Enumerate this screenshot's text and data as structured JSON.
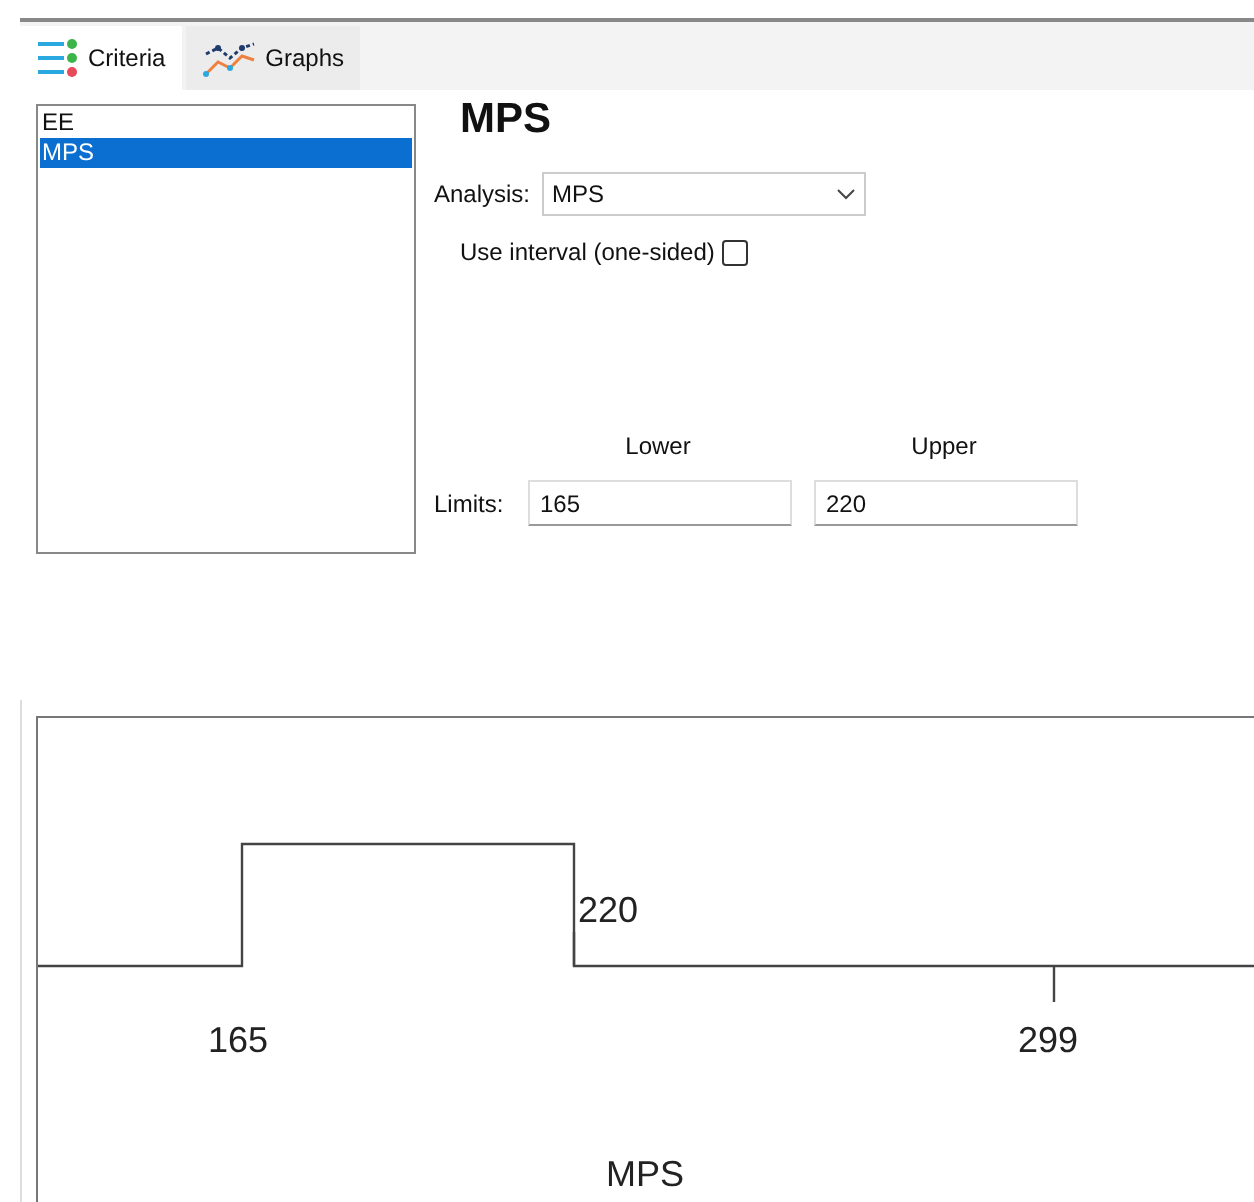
{
  "tabs": [
    {
      "label": "Criteria",
      "kind": "criteria",
      "selected": true
    },
    {
      "label": "Graphs",
      "kind": "graphs",
      "selected": false
    }
  ],
  "criteria_list": [
    {
      "label": "EE",
      "selected": false
    },
    {
      "label": "MPS",
      "selected": true
    }
  ],
  "title": "MPS",
  "analysis": {
    "label": "Analysis:",
    "value": "MPS"
  },
  "interval": {
    "label": "Use interval (one-sided)",
    "checked": false
  },
  "limits": {
    "label": "Limits:",
    "lower_heading": "Lower",
    "upper_heading": "Upper",
    "lower": "165",
    "upper": "220"
  },
  "limits_plot": {
    "lower_label": "165",
    "upper_label": "220",
    "max_label": "299",
    "xlabel": "MPS"
  }
}
